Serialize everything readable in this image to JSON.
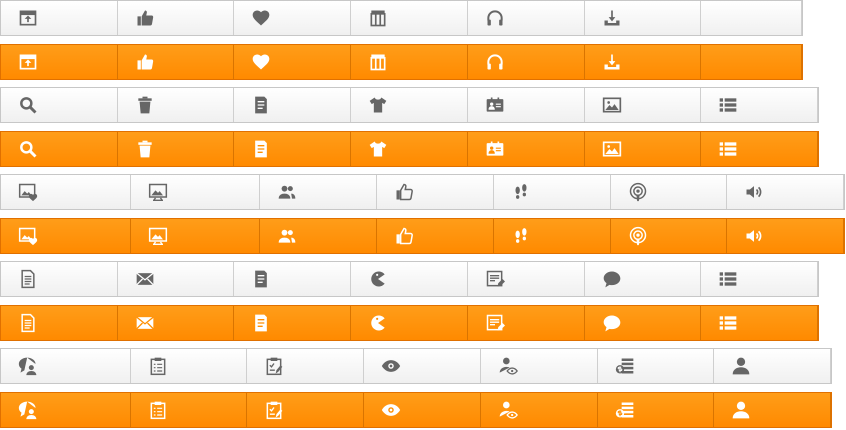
{
  "rows": [
    {
      "theme": "gray",
      "icons": [
        "upload-window",
        "thumbs-up",
        "heart",
        "calendar-columns",
        "headphones",
        "download-tray",
        ""
      ]
    },
    {
      "theme": "orange",
      "icons": [
        "upload-window",
        "thumbs-up",
        "heart",
        "calendar-columns",
        "headphones",
        "download-tray",
        ""
      ]
    },
    {
      "theme": "gray",
      "icons": [
        "search",
        "trash",
        "document",
        "t-shirt",
        "id-card",
        "image",
        "list"
      ]
    },
    {
      "theme": "orange",
      "icons": [
        "search",
        "trash",
        "document",
        "t-shirt",
        "id-card",
        "image",
        "list"
      ]
    },
    {
      "theme": "gray",
      "icons": [
        "picture-heart",
        "picture-slideshow",
        "users",
        "thumbs-up-outline",
        "footprints",
        "podcast",
        "speaker"
      ]
    },
    {
      "theme": "orange",
      "icons": [
        "picture-heart",
        "picture-slideshow",
        "users",
        "thumbs-up-outline",
        "footprints",
        "podcast",
        "speaker"
      ]
    },
    {
      "theme": "gray",
      "icons": [
        "text-file",
        "mail",
        "document",
        "pacman",
        "note-pen",
        "chat-bubble",
        "list"
      ]
    },
    {
      "theme": "orange",
      "icons": [
        "text-file",
        "mail",
        "document",
        "pacman",
        "note-pen",
        "chat-bubble",
        "list"
      ]
    },
    {
      "theme": "gray",
      "icons": [
        "chat-user",
        "clipboard",
        "clipboard-check",
        "eye",
        "user-view",
        "money-stack",
        "user"
      ]
    },
    {
      "theme": "orange",
      "icons": [
        "chat-user",
        "clipboard",
        "clipboard-check",
        "eye",
        "user-view",
        "money-stack",
        "user"
      ]
    }
  ],
  "colors": {
    "gray_icon": "#666666",
    "orange_bg": "#ff8f00",
    "white": "#ffffff"
  }
}
